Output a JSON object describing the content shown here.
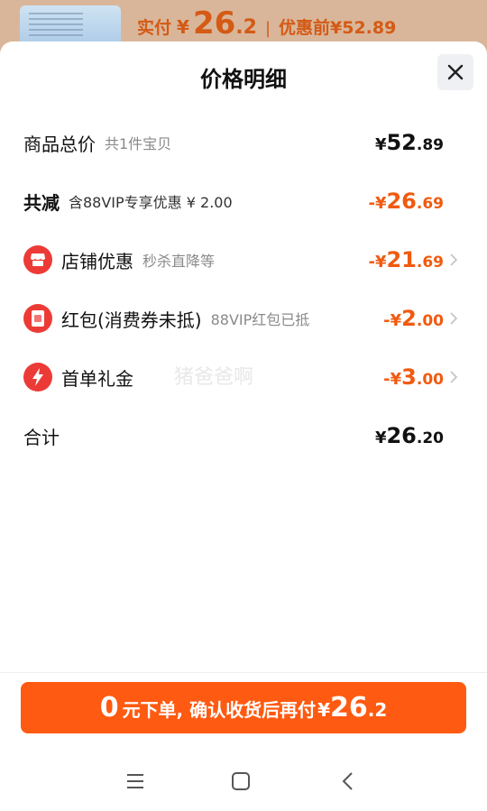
{
  "top": {
    "paid_label": "实付",
    "currency": "¥",
    "paid_int": "26",
    "paid_dec": ".2",
    "separator": "|",
    "before_label": "优惠前¥52.89"
  },
  "sheet": {
    "title": "价格明细"
  },
  "rows": [
    {
      "label": "商品总价",
      "sub": "共1件宝贝",
      "currency": "¥",
      "int": "52",
      "dec": ".89"
    },
    {
      "label": "共减",
      "sub": "含88VIP专享优惠 ¥ 2.00",
      "currency": "-¥",
      "int": "26",
      "dec": ".69"
    },
    {
      "label": "店铺优惠",
      "sub": "秒杀直降等",
      "currency": "-¥",
      "int": "21",
      "dec": ".69"
    },
    {
      "label": "红包(消费券未抵)",
      "sub": "88VIP红包已抵",
      "currency": "-¥",
      "int": "2",
      "dec": ".00"
    },
    {
      "label": "首单礼金",
      "sub": "",
      "currency": "-¥",
      "int": "3",
      "dec": ".00"
    },
    {
      "label": "合计",
      "sub": "",
      "currency": "¥",
      "int": "26",
      "dec": ".20"
    }
  ],
  "watermark": "猪爸爸啊",
  "cta": {
    "zero": "0",
    "text": "元下单, 确认收货后再付",
    "currency": "¥",
    "int": "26",
    "dec": ".2"
  },
  "colors": {
    "accent": "#ff5a11",
    "discount": "#f15a0f",
    "icon_red": "#ec3b37"
  },
  "icons": {
    "shop": "store-icon",
    "redpacket": "red-packet-icon",
    "flash": "lightning-icon",
    "close": "close-icon",
    "chevron": "chevron-right-icon",
    "nav": [
      "menu-icon",
      "home-square-icon",
      "back-icon"
    ]
  }
}
